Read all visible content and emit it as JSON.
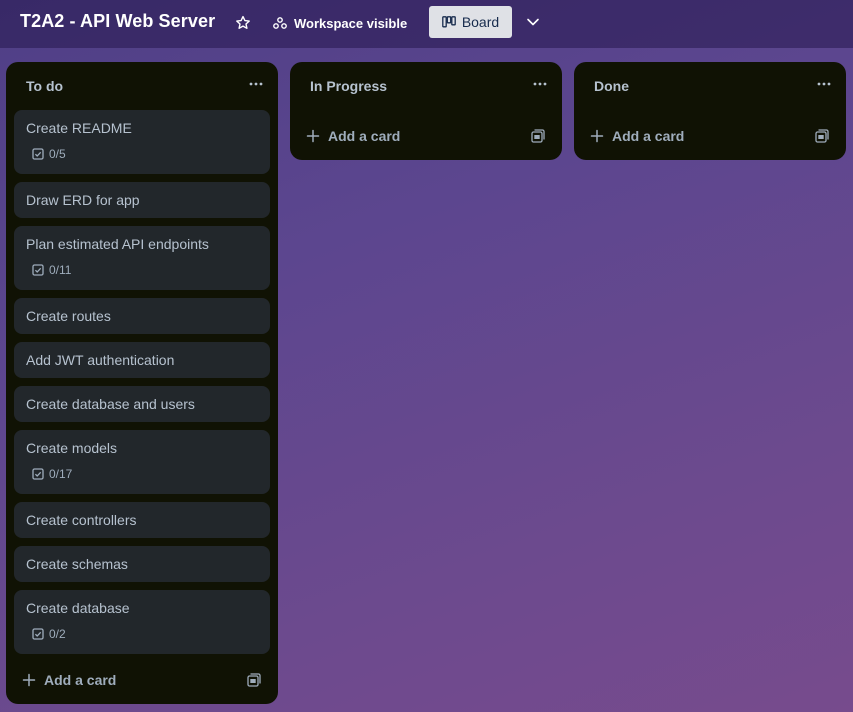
{
  "header": {
    "board_title": "T2A2 - API Web Server",
    "visibility_label": "Workspace visible",
    "view_label": "Board"
  },
  "colors": {
    "list_bg": "#101204",
    "card_bg": "#22272b",
    "text": "#b6c2cf",
    "subtle_text": "#9fadbc",
    "board_button_bg": "#dfe1e6"
  },
  "lists": [
    {
      "title": "To do",
      "add_card_label": "Add a card",
      "cards": [
        {
          "title": "Create README",
          "checklist": "0/5"
        },
        {
          "title": "Draw ERD for app"
        },
        {
          "title": "Plan estimated API endpoints",
          "checklist": "0/11"
        },
        {
          "title": "Create routes"
        },
        {
          "title": "Add JWT authentication"
        },
        {
          "title": "Create database and users"
        },
        {
          "title": "Create models",
          "checklist": "0/17"
        },
        {
          "title": "Create controllers"
        },
        {
          "title": "Create schemas"
        },
        {
          "title": "Create database",
          "checklist": "0/2"
        }
      ]
    },
    {
      "title": "In Progress",
      "add_card_label": "Add a card",
      "cards": []
    },
    {
      "title": "Done",
      "add_card_label": "Add a card",
      "cards": []
    }
  ],
  "icons": {
    "star": "star-icon",
    "visibility": "workspace-icon",
    "board": "board-icon",
    "chevron": "chevron-down-icon",
    "list_menu": "more-icon",
    "checklist": "checklist-icon",
    "add": "plus-icon",
    "template": "card-template-icon"
  }
}
